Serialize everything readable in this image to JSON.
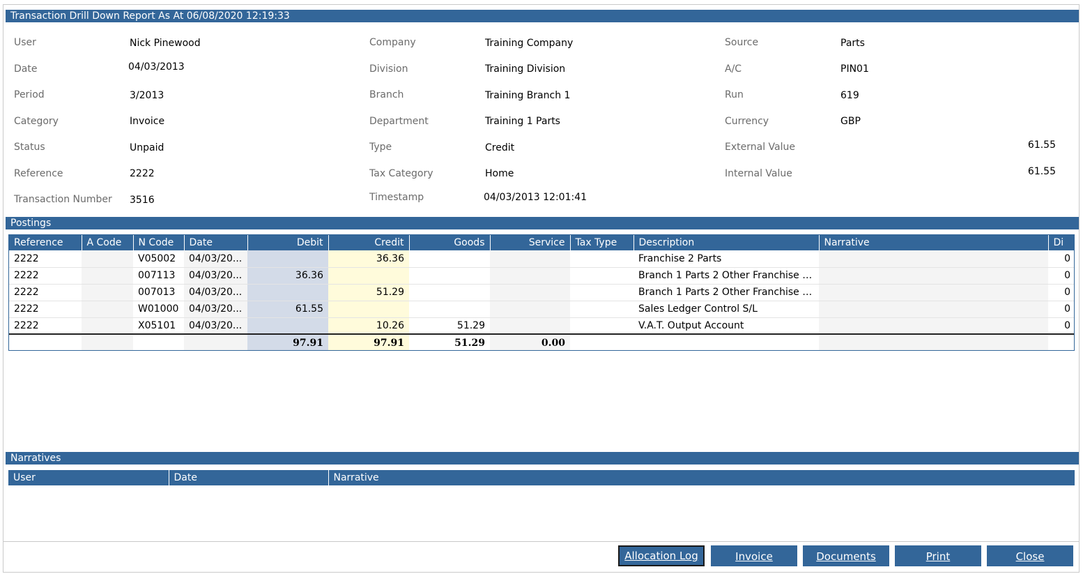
{
  "title": "Transaction Drill Down Report As At 06/08/2020 12:19:33",
  "fields": {
    "user": {
      "label": "User",
      "value": "Nick Pinewood"
    },
    "date": {
      "label": "Date",
      "value": "04/03/2013"
    },
    "period": {
      "label": "Period",
      "value": "3/2013"
    },
    "category": {
      "label": "Category",
      "value": "Invoice"
    },
    "status": {
      "label": "Status",
      "value": "Unpaid"
    },
    "reference": {
      "label": "Reference",
      "value": "2222"
    },
    "transaction_number": {
      "label": "Transaction Number",
      "value": "3516"
    },
    "company": {
      "label": "Company",
      "value": "Training Company"
    },
    "division": {
      "label": "Division",
      "value": "Training Division"
    },
    "branch": {
      "label": "Branch",
      "value": "Training Branch 1"
    },
    "department": {
      "label": "Department",
      "value": "Training 1 Parts"
    },
    "type": {
      "label": "Type",
      "value": "Credit"
    },
    "tax_category": {
      "label": "Tax Category",
      "value": "Home"
    },
    "timestamp": {
      "label": "Timestamp",
      "value": "04/03/2013 12:01:41"
    },
    "source": {
      "label": "Source",
      "value": "Parts"
    },
    "ac": {
      "label": "A/C",
      "value": "PIN01"
    },
    "run": {
      "label": "Run",
      "value": "619"
    },
    "currency": {
      "label": "Currency",
      "value": "GBP"
    },
    "external_value": {
      "label": "External Value",
      "value": "61.55"
    },
    "internal_value": {
      "label": "Internal Value",
      "value": "61.55"
    }
  },
  "postings": {
    "section_title": "Postings",
    "headers": [
      "Reference",
      "A Code",
      "N Code",
      "Date",
      "Debit",
      "Credit",
      "Goods",
      "Service",
      "Tax Type",
      "Description",
      "Narrative",
      "Di"
    ],
    "rows": [
      [
        "2222",
        "",
        "V05002",
        "04/03/20...",
        "",
        "36.36",
        "",
        "",
        "",
        "Franchise 2 Parts",
        "",
        "0"
      ],
      [
        "2222",
        "",
        "007113",
        "04/03/20...",
        "36.36",
        "",
        "",
        "",
        "",
        "Branch 1 Parts 2 Other Franchise D...",
        "",
        "0"
      ],
      [
        "2222",
        "",
        "007013",
        "04/03/20...",
        "",
        "51.29",
        "",
        "",
        "",
        "Branch 1 Parts 2 Other Franchise D...",
        "",
        "0"
      ],
      [
        "2222",
        "",
        "W01000",
        "04/03/20...",
        "61.55",
        "",
        "",
        "",
        "",
        "Sales Ledger Control S/L",
        "",
        "0"
      ],
      [
        "2222",
        "",
        "X05101",
        "04/03/20...",
        "",
        "10.26",
        "51.29",
        "",
        "",
        "V.A.T. Output Account",
        "",
        "0"
      ]
    ],
    "totals": [
      "",
      "",
      "",
      "",
      "97.91",
      "97.91",
      "51.29",
      "0.00",
      "",
      "",
      "",
      ""
    ]
  },
  "narratives": {
    "section_title": "Narratives",
    "headers": [
      "User",
      "Date",
      "Narrative"
    ]
  },
  "buttons": {
    "allocation_log": "Allocation Log",
    "invoice": "Invoice",
    "documents": "Documents",
    "print": "Print",
    "close": "Close"
  }
}
